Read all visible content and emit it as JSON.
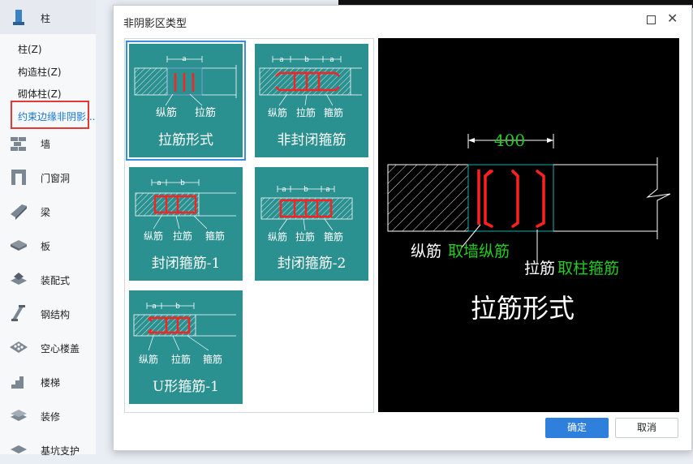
{
  "sidebar": {
    "header_label": "柱",
    "sub_items": [
      {
        "label": "柱(Z)"
      },
      {
        "label": "构造柱(Z)"
      },
      {
        "label": "砌体柱(Z)"
      },
      {
        "label": "约束边缘非阴影..."
      }
    ],
    "categories": [
      {
        "label": "墙",
        "icon": "wall-icon"
      },
      {
        "label": "门窗洞",
        "icon": "door-window-icon"
      },
      {
        "label": "梁",
        "icon": "beam-icon"
      },
      {
        "label": "板",
        "icon": "slab-icon"
      },
      {
        "label": "装配式",
        "icon": "prefab-icon"
      },
      {
        "label": "钢结构",
        "icon": "steel-structure-icon"
      },
      {
        "label": "空心楼盖",
        "icon": "hollow-floor-icon"
      },
      {
        "label": "楼梯",
        "icon": "stairs-icon"
      },
      {
        "label": "装修",
        "icon": "decoration-icon"
      },
      {
        "label": "基坑支护",
        "icon": "foundation-support-icon"
      }
    ]
  },
  "dialog": {
    "title": "非阴影区类型",
    "ok_label": "确定",
    "cancel_label": "取消"
  },
  "options": [
    {
      "caption": "拉筋形式",
      "labels": [
        "纵筋",
        "拉筋"
      ],
      "dims": [
        "a"
      ]
    },
    {
      "caption": "非封闭箍筋",
      "labels": [
        "纵筋",
        "拉筋",
        "箍筋"
      ],
      "dims": [
        "a",
        "b",
        "a"
      ]
    },
    {
      "caption": "封闭箍筋-1",
      "labels": [
        "纵筋",
        "拉筋",
        "箍筋"
      ],
      "dims": [
        "a",
        "b"
      ]
    },
    {
      "caption": "封闭箍筋-2",
      "labels": [
        "纵筋",
        "拉筋",
        "箍筋"
      ],
      "dims": [
        "a",
        "b",
        "a"
      ]
    },
    {
      "caption": "U形箍筋-1",
      "labels": [
        "纵筋",
        "拉筋",
        "箍筋"
      ],
      "dims": [
        "a",
        "b"
      ]
    }
  ],
  "selected_option": "拉筋形式",
  "preview": {
    "dimension": "400",
    "label1": "纵筋",
    "label1_note": "取墙纵筋",
    "label2": "拉筋",
    "label2_note": "取柱箍筋",
    "caption": "拉筋形式"
  },
  "colors": {
    "card_bg": "#2b9090",
    "rebar_red": "#ff2020",
    "preview_green": "#22cc22",
    "selection_blue": "#3a8de0",
    "primary_button": "#2f7fdc"
  }
}
